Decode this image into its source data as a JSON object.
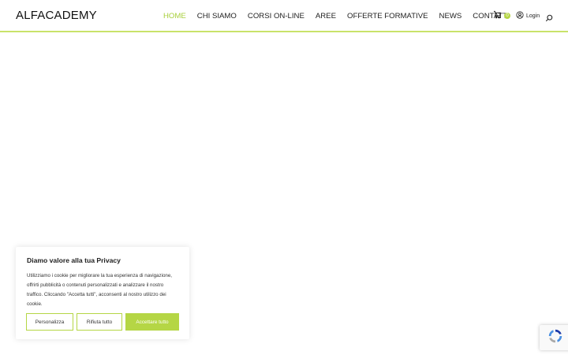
{
  "header": {
    "logo": "ALFACADEMY",
    "nav": [
      {
        "label": "HOME",
        "active": true
      },
      {
        "label": "CHI SIAMO",
        "active": false
      },
      {
        "label": "CORSI ON-LINE",
        "active": false
      },
      {
        "label": "AREE",
        "active": false
      },
      {
        "label": "OFFERTE FORMATIVE",
        "active": false
      },
      {
        "label": "NEWS",
        "active": false
      },
      {
        "label": "CONTATTI",
        "active": false
      }
    ],
    "cart_count": "0",
    "login_label": "Login"
  },
  "cookie": {
    "title": "Diamo valore alla tua Privacy",
    "text": "Utilizziamo i cookie per migliorare la tua esperienza di navigazione, offrirti pubblicità o contenuti personalizzati e analizzare il nostro traffico. Cliccando \"Accetta tutti\", acconsenti al nostro utilizzo dei cookie.",
    "customize_label": "Personalizza",
    "reject_label": "Rifiuta tutto",
    "accept_label": "Accettare tutto"
  },
  "colors": {
    "accent": "#b5d645",
    "nav_active": "#a8cf3c"
  },
  "icons": {
    "cart": "cart-icon",
    "login": "user-circle-icon",
    "search": "search-icon",
    "recaptcha": "recaptcha-icon"
  }
}
